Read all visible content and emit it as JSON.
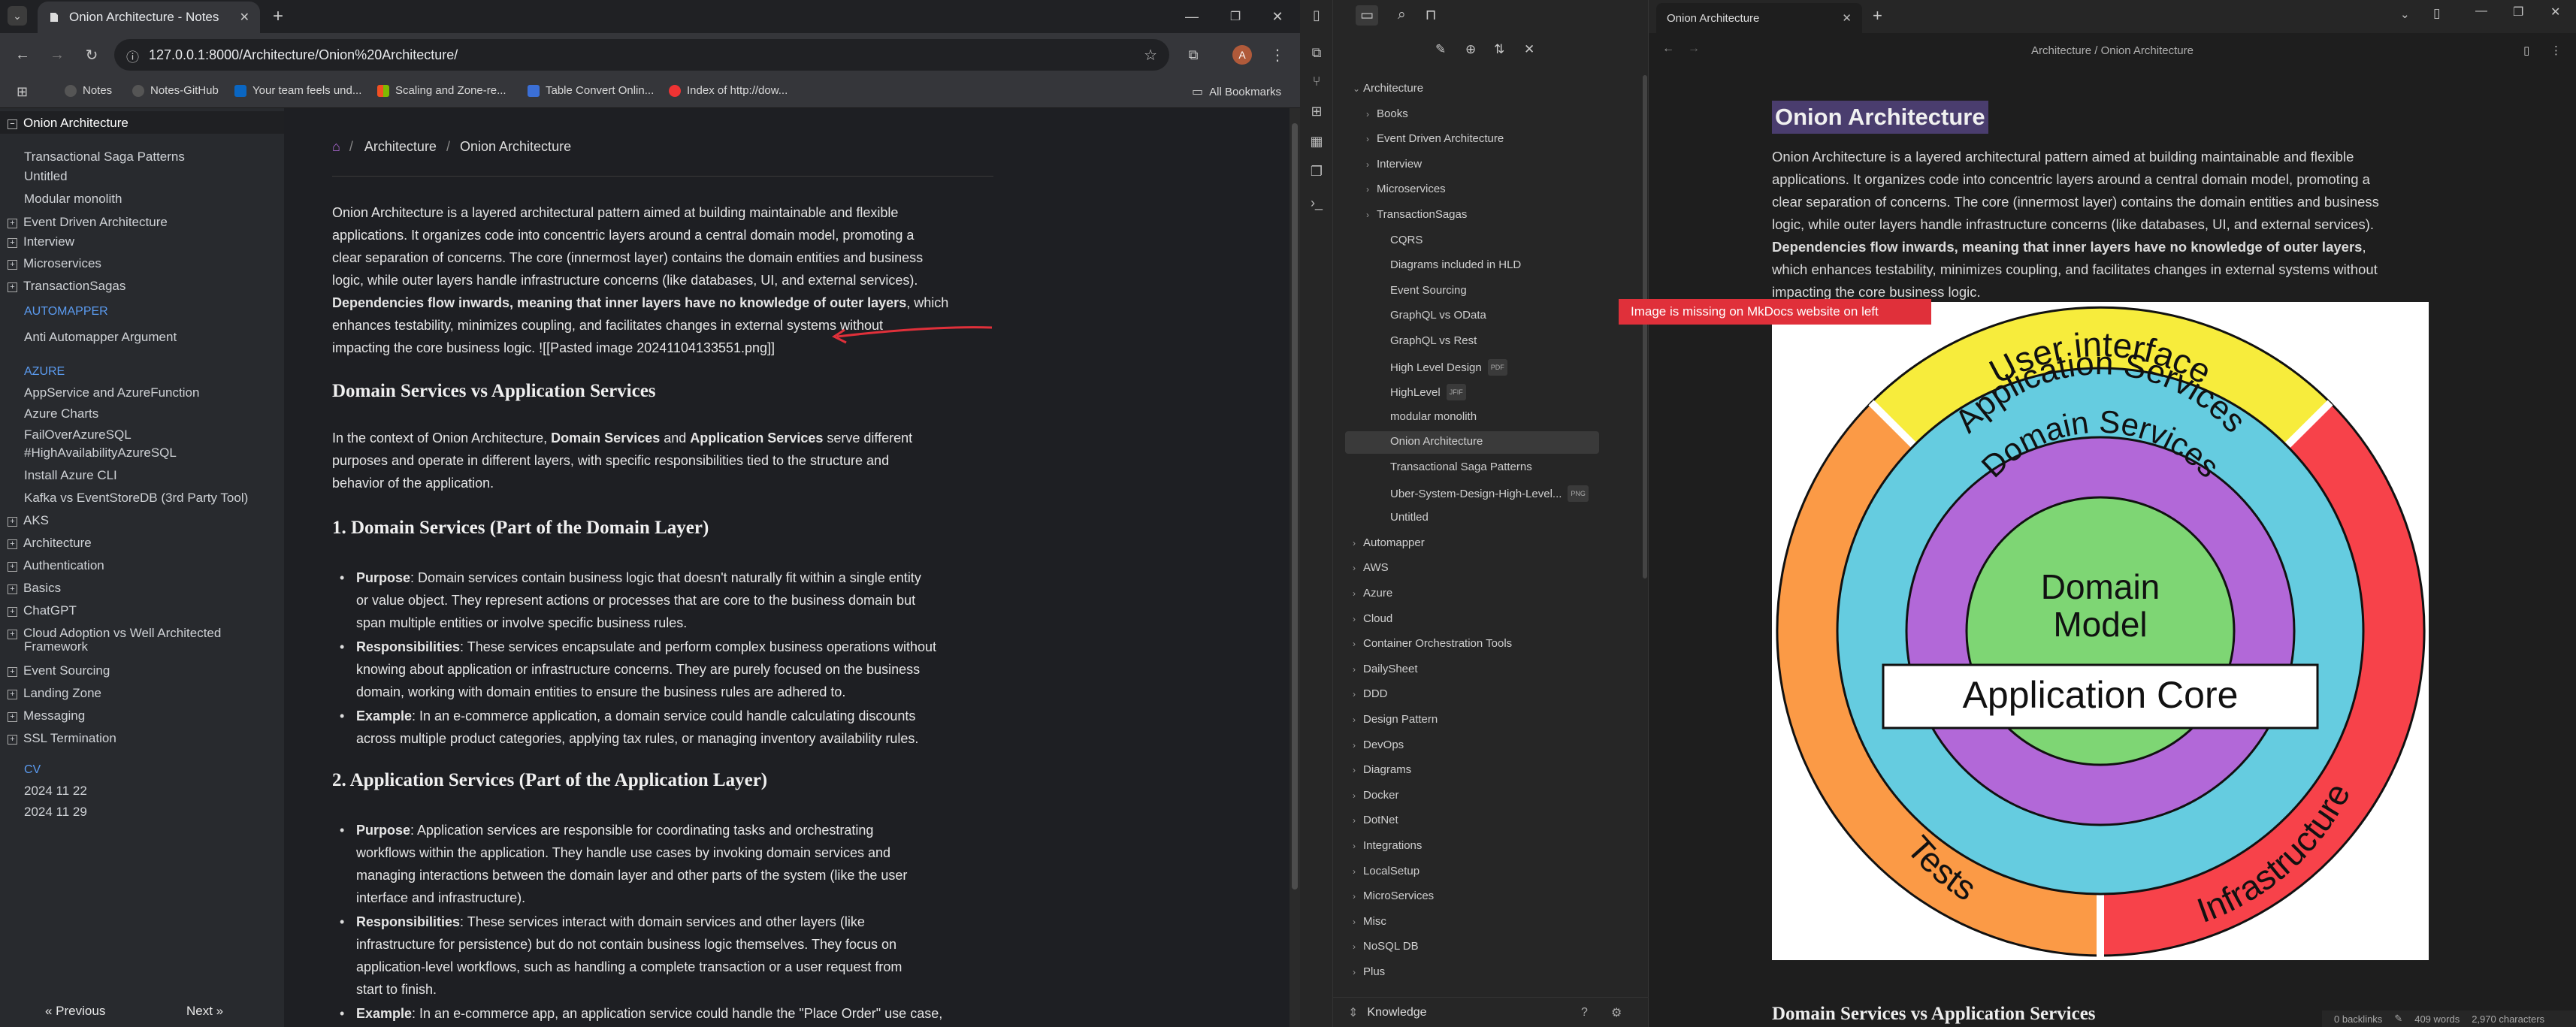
{
  "browser": {
    "tab_title": "Onion Architecture - Notes",
    "url": "127.0.0.1:8000/Architecture/Onion%20Architecture/",
    "profile_initial": "A",
    "bookmarks": [
      "Notes",
      "Notes-GitHub",
      "Your team feels und...",
      "Scaling and Zone-re...",
      "Table Convert Onlin...",
      "Index of http://dow..."
    ],
    "all_bookmarks": "All Bookmarks"
  },
  "site_nav": {
    "title": "Onion Architecture",
    "items": [
      {
        "label": "Transactional Saga Patterns",
        "kind": "child"
      },
      {
        "label": "Untitled",
        "kind": "child"
      },
      {
        "label": "Modular monolith",
        "kind": "child"
      },
      {
        "label": "Event Driven Architecture",
        "kind": "folder"
      },
      {
        "label": "Interview",
        "kind": "folder"
      },
      {
        "label": "Microservices",
        "kind": "folder"
      },
      {
        "label": "TransactionSagas",
        "kind": "folder"
      },
      {
        "label": "AUTOMAPPER",
        "kind": "section"
      },
      {
        "label": "Anti Automapper Argument",
        "kind": "child"
      },
      {
        "label": "AZURE",
        "kind": "section"
      },
      {
        "label": "AppService and AzureFunction",
        "kind": "child"
      },
      {
        "label": "Azure Charts",
        "kind": "child"
      },
      {
        "label": "FailOverAzureSQL",
        "kind": "child"
      },
      {
        "label": "#HighAvailabilityAzureSQL",
        "kind": "child"
      },
      {
        "label": "Install Azure CLI",
        "kind": "child"
      },
      {
        "label": "Kafka vs EventStoreDB (3rd Party Tool)",
        "kind": "child"
      },
      {
        "label": "AKS",
        "kind": "folder"
      },
      {
        "label": "Architecture",
        "kind": "folder"
      },
      {
        "label": "Authentication",
        "kind": "folder"
      },
      {
        "label": "Basics",
        "kind": "folder"
      },
      {
        "label": "ChatGPT",
        "kind": "folder"
      },
      {
        "label": "Cloud Adoption vs Well Architected",
        "kind": "folder"
      },
      {
        "label": "Framework",
        "kind": "child"
      },
      {
        "label": "Event Sourcing",
        "kind": "folder"
      },
      {
        "label": "Landing Zone",
        "kind": "folder"
      },
      {
        "label": "Messaging",
        "kind": "folder"
      },
      {
        "label": "SSL Termination",
        "kind": "folder"
      },
      {
        "label": "CV",
        "kind": "section"
      },
      {
        "label": "2024 11 22",
        "kind": "child"
      },
      {
        "label": "2024 11 29",
        "kind": "child"
      }
    ],
    "prev": "« Previous",
    "next": "Next »"
  },
  "article": {
    "crumb_home": "⌂",
    "crumb_1": "Architecture",
    "crumb_sep": "/",
    "crumb_2": "Onion Architecture",
    "intro_lines": [
      "Onion Architecture is a layered architectural pattern aimed at building maintainable and flexible",
      "applications. It organizes code into concentric layers around a central domain model, promoting a",
      "clear separation of concerns. The core (innermost layer) contains the domain entities and business",
      "logic, while outer layers handle infrastructure concerns (like databases, UI, and external services)."
    ],
    "intro_bold": "Dependencies flow inwards, meaning that inner layers have no knowledge of outer layers",
    "intro_rest": ", which",
    "intro_lines_2": [
      "enhances testability, minimizes coupling, and facilitates changes in external systems without",
      "impacting the core business logic. ![[Pasted image 20241104133551.png]]"
    ],
    "h_domain_vs_app": "Domain Services vs Application Services",
    "p2_pre": "In the context of Onion Architecture, ",
    "p2_b1": "Domain Services",
    "p2_and": " and ",
    "p2_b2": "Application Services",
    "p2_post": " serve different",
    "p2_lines": [
      "purposes and operate in different layers, with specific responsibilities tied to the structure and",
      "behavior of the application."
    ],
    "h1": "1. Domain Services (Part of the Domain Layer)",
    "ds": [
      {
        "label": "Purpose",
        "lines": [
          ": Domain services contain business logic that doesn't naturally fit within a single entity",
          "or value object. They represent actions or processes that are core to the business domain but",
          "span multiple entities or involve specific business rules."
        ]
      },
      {
        "label": "Responsibilities",
        "lines": [
          ": These services encapsulate and perform complex business operations without",
          "knowing about application or infrastructure concerns. They are purely focused on the business",
          "domain, working with domain entities to ensure the business rules are adhered to."
        ]
      },
      {
        "label": "Example",
        "lines": [
          ": In an e-commerce application, a domain service could handle calculating discounts",
          "across multiple product categories, applying tax rules, or managing inventory availability rules."
        ]
      }
    ],
    "h2": "2. Application Services (Part of the Application Layer)",
    "as": [
      {
        "label": "Purpose",
        "lines": [
          ": Application services are responsible for coordinating tasks and orchestrating",
          "workflows within the application. They handle use cases by invoking domain services and",
          "managing interactions between the domain layer and other parts of the system (like the user",
          "interface and infrastructure)."
        ]
      },
      {
        "label": "Responsibilities",
        "lines": [
          ": These services interact with domain services and other layers (like",
          "infrastructure for persistence) but do not contain business logic themselves. They focus on",
          "application-level workflows, such as handling a complete transaction or a user request from",
          "start to finish."
        ]
      },
      {
        "label": "Example",
        "lines": [
          ": In an e-commerce app, an application service could handle the \"Place Order\" use case,"
        ]
      }
    ]
  },
  "obsidian": {
    "tab_title": "Onion Architecture",
    "crumb": "Architecture / Onion Architecture",
    "vault": "Knowledge",
    "tree": [
      {
        "label": "Architecture",
        "depth": 0,
        "arrow": "⌄"
      },
      {
        "label": "Books",
        "depth": 1,
        "arrow": "›"
      },
      {
        "label": "Event Driven Architecture",
        "depth": 1,
        "arrow": "›"
      },
      {
        "label": "Interview",
        "depth": 1,
        "arrow": "›"
      },
      {
        "label": "Microservices",
        "depth": 1,
        "arrow": "›"
      },
      {
        "label": "TransactionSagas",
        "depth": 1,
        "arrow": "›"
      },
      {
        "label": "CQRS",
        "depth": 2,
        "arrow": ""
      },
      {
        "label": "Diagrams included in HLD",
        "depth": 2,
        "arrow": ""
      },
      {
        "label": "Event Sourcing",
        "depth": 2,
        "arrow": ""
      },
      {
        "label": "GraphQL vs OData",
        "depth": 2,
        "arrow": ""
      },
      {
        "label": "GraphQL vs Rest",
        "depth": 2,
        "arrow": ""
      },
      {
        "label": "High Level Design",
        "depth": 2,
        "arrow": "",
        "tag": "PDF"
      },
      {
        "label": "HighLevel",
        "depth": 2,
        "arrow": "",
        "tag": "JFIF"
      },
      {
        "label": "modular monolith",
        "depth": 2,
        "arrow": ""
      },
      {
        "label": "Onion Architecture",
        "depth": 2,
        "arrow": ""
      },
      {
        "label": "Transactional Saga Patterns",
        "depth": 2,
        "arrow": ""
      },
      {
        "label": "Uber-System-Design-High-Level...",
        "depth": 2,
        "arrow": "",
        "tag": "PNG"
      },
      {
        "label": "Untitled",
        "depth": 2,
        "arrow": ""
      },
      {
        "label": "Automapper",
        "depth": 0,
        "arrow": "›"
      },
      {
        "label": "AWS",
        "depth": 0,
        "arrow": "›"
      },
      {
        "label": "Azure",
        "depth": 0,
        "arrow": "›"
      },
      {
        "label": "Cloud",
        "depth": 0,
        "arrow": "›"
      },
      {
        "label": "Container Orchestration Tools",
        "depth": 0,
        "arrow": "›"
      },
      {
        "label": "DailySheet",
        "depth": 0,
        "arrow": "›"
      },
      {
        "label": "DDD",
        "depth": 0,
        "arrow": "›"
      },
      {
        "label": "Design Pattern",
        "depth": 0,
        "arrow": "›"
      },
      {
        "label": "DevOps",
        "depth": 0,
        "arrow": "›"
      },
      {
        "label": "Diagrams",
        "depth": 0,
        "arrow": "›"
      },
      {
        "label": "Docker",
        "depth": 0,
        "arrow": "›"
      },
      {
        "label": "DotNet",
        "depth": 0,
        "arrow": "›"
      },
      {
        "label": "Integrations",
        "depth": 0,
        "arrow": "›"
      },
      {
        "label": "LocalSetup",
        "depth": 0,
        "arrow": "›"
      },
      {
        "label": "MicroServices",
        "depth": 0,
        "arrow": "›"
      },
      {
        "label": "Misc",
        "depth": 0,
        "arrow": "›"
      },
      {
        "label": "NoSQL DB",
        "depth": 0,
        "arrow": "›"
      },
      {
        "label": "Plus",
        "depth": 0,
        "arrow": "›"
      }
    ],
    "note_title": "Onion Architecture",
    "note_lines": [
      "Onion Architecture is a layered architectural pattern aimed at building maintainable and flexible",
      "applications. It organizes code into concentric layers around a central domain model, promoting a",
      "clear separation of concerns. The core (innermost layer) contains the domain entities and business",
      "logic, while outer layers handle infrastructure concerns (like databases, UI, and external services)."
    ],
    "note_bold": "Dependencies flow inwards, meaning that inner layers have no knowledge of outer layers",
    "note_rest": ",",
    "note_lines_2": [
      "which enhances testability, minimizes coupling, and facilitates changes in external systems without",
      "impacting the core business logic."
    ],
    "annotation": "Image is missing on MkDocs website on left",
    "diagram": {
      "user_interface": "User interface",
      "application_services": "Application Services",
      "domain_services": "Domain Services",
      "domain_model_1": "Domain",
      "domain_model_2": "Model",
      "application_core": "Application Core",
      "tests": "Tests",
      "infrastructure": "Infrastructure",
      "colors": {
        "ui": "#f7ec3c",
        "app": "#65cce0",
        "dom": "#b268d8",
        "model": "#7ed674",
        "tests": "#fb9a46",
        "infra": "#f7424a"
      }
    },
    "next_heading": "Domain Services vs Application Services",
    "status": {
      "backlinks": "0 backlinks",
      "words": "409 words",
      "chars": "2,970 characters"
    }
  }
}
